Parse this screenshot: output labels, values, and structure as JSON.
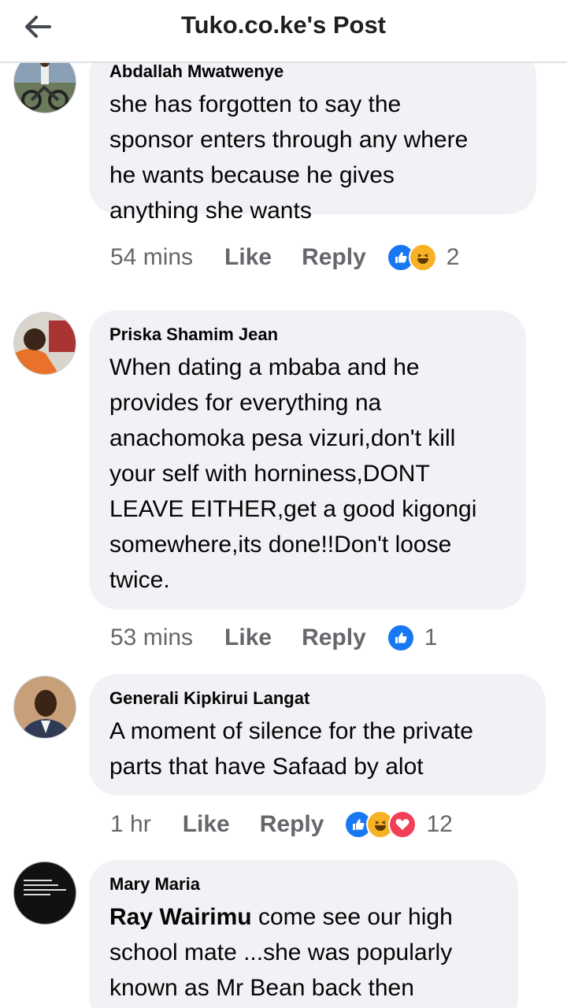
{
  "header": {
    "title": "Tuko.co.ke's Post"
  },
  "comments": [
    {
      "author": "Abdallah Mwatwenye",
      "lines": [
        "she has forgotten to say the",
        "sponsor enters through any where",
        "he wants because he gives",
        "anything she wants"
      ],
      "time": "54 mins",
      "like": "Like",
      "reply": "Reply",
      "reactions": [
        "like",
        "haha"
      ],
      "count": "2"
    },
    {
      "author": "Priska Shamim Jean",
      "lines": [
        "When dating a mbaba and he",
        "provides for everything na",
        "anachomoka pesa vizuri,don't kill",
        "your self with horniness,DONT",
        "LEAVE EITHER,get a good kigongi",
        "somewhere,its done!!Don't loose",
        "twice."
      ],
      "time": "53 mins",
      "like": "Like",
      "reply": "Reply",
      "reactions": [
        "like"
      ],
      "count": "1"
    },
    {
      "author": "Generali Kipkirui Langat",
      "lines": [
        "A moment of silence for the private",
        "parts that have Safaad by alot"
      ],
      "time": "1 hr",
      "like": "Like",
      "reply": "Reply",
      "reactions": [
        "like",
        "haha",
        "love"
      ],
      "count": "12"
    },
    {
      "author": "Mary Maria",
      "mention": "Ray Wairimu",
      "lines_after_mention": [
        " come see our high",
        "school mate ...she was popularly",
        "known as Mr Bean back then"
      ],
      "avatar_text": "IT'S A SLOW PROCESS, BUT QUITTING WON'T SPEED IT UP."
    }
  ]
}
